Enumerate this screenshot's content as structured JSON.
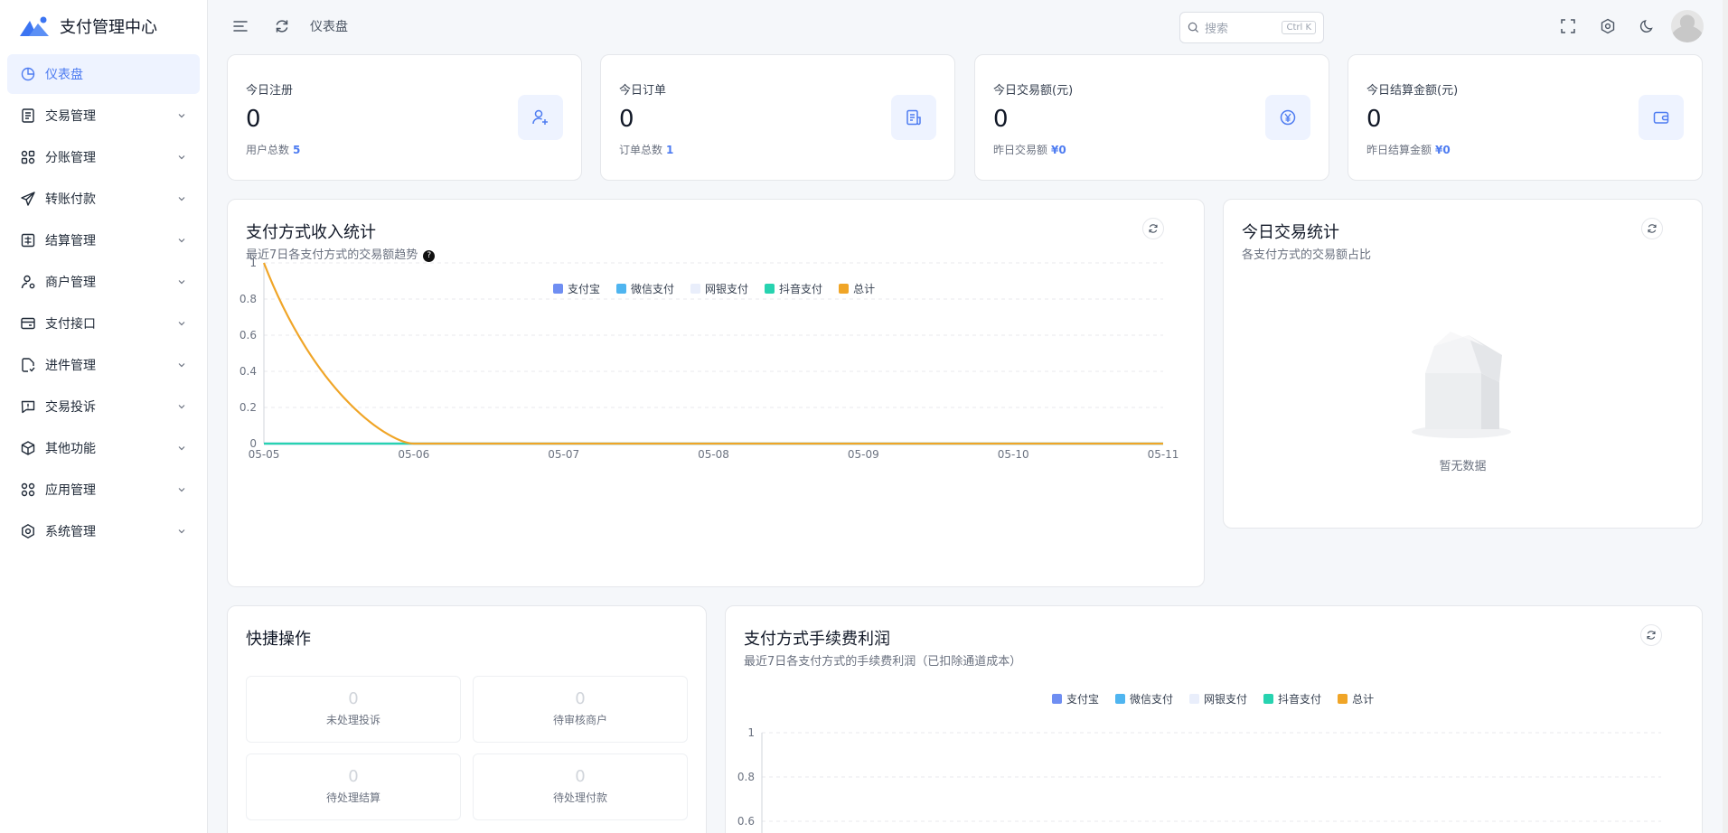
{
  "app": {
    "title": "支付管理中心"
  },
  "sidebar": {
    "items": [
      {
        "label": "仪表盘",
        "icon": "pie-chart-icon",
        "active": true
      },
      {
        "label": "交易管理",
        "icon": "document-icon"
      },
      {
        "label": "分账管理",
        "icon": "split-icon"
      },
      {
        "label": "转账付款",
        "icon": "send-icon"
      },
      {
        "label": "结算管理",
        "icon": "settlement-icon"
      },
      {
        "label": "商户管理",
        "icon": "user-settings-icon"
      },
      {
        "label": "支付接口",
        "icon": "card-icon"
      },
      {
        "label": "进件管理",
        "icon": "file-check-icon"
      },
      {
        "label": "交易投诉",
        "icon": "alert-message-icon"
      },
      {
        "label": "其他功能",
        "icon": "box-icon"
      },
      {
        "label": "应用管理",
        "icon": "apps-icon"
      },
      {
        "label": "系统管理",
        "icon": "settings-icon"
      }
    ]
  },
  "header": {
    "breadcrumb": "仪表盘",
    "search_placeholder": "搜索",
    "search_shortcut": "Ctrl K"
  },
  "stats": [
    {
      "label": "今日注册",
      "value": "0",
      "sub_label": "用户总数",
      "sub_value": "5",
      "icon": "user-plus-icon"
    },
    {
      "label": "今日订单",
      "value": "0",
      "sub_label": "订单总数",
      "sub_value": "1",
      "icon": "order-icon"
    },
    {
      "label": "今日交易额(元)",
      "value": "0",
      "sub_label": "昨日交易额",
      "sub_value": "¥0",
      "icon": "yen-icon"
    },
    {
      "label": "今日结算金额(元)",
      "value": "0",
      "sub_label": "昨日结算金额",
      "sub_value": "¥0",
      "icon": "wallet-icon"
    }
  ],
  "income_chart": {
    "title": "支付方式收入统计",
    "subtitle": "最近7日各支付方式的交易额趋势"
  },
  "today_chart": {
    "title": "今日交易统计",
    "subtitle": "各支付方式的交易额占比",
    "empty_text": "暂无数据"
  },
  "quick_actions": {
    "title": "快捷操作",
    "items": [
      {
        "value": "0",
        "label": "未处理投诉"
      },
      {
        "value": "0",
        "label": "待审核商户"
      },
      {
        "value": "0",
        "label": "待处理结算"
      },
      {
        "value": "0",
        "label": "待处理付款"
      }
    ]
  },
  "fee_chart": {
    "title": "支付方式手续费利润",
    "subtitle": "最近7日各支付方式的手续费利润（已扣除通道成本）"
  },
  "colors": {
    "accent": "#4e7cf1",
    "alipay": "#6f8ef2",
    "wechat": "#4fb5f0",
    "bank": "#e9eefb",
    "douyin": "#27d3b0",
    "total": "#f0a527"
  },
  "chart_data": [
    {
      "type": "line",
      "x": [
        "05-05",
        "05-06",
        "05-07",
        "05-08",
        "05-09",
        "05-10",
        "05-11"
      ],
      "ylim": [
        0,
        1
      ],
      "yticks": [
        "0",
        "0.2",
        "0.4",
        "0.6",
        "0.8",
        "1"
      ],
      "legend": "top-center",
      "grid": true,
      "series": [
        {
          "name": "支付宝",
          "values": [
            0,
            0,
            0,
            0,
            0,
            0,
            0
          ],
          "color": "#6f8ef2"
        },
        {
          "name": "微信支付",
          "values": [
            0,
            0,
            0,
            0,
            0,
            0,
            0
          ],
          "color": "#4fb5f0"
        },
        {
          "name": "网银支付",
          "values": [
            0,
            0,
            0,
            0,
            0,
            0,
            0
          ],
          "color": "#e9eefb"
        },
        {
          "name": "抖音支付",
          "values": [
            0,
            0,
            0,
            0,
            0,
            0,
            0
          ],
          "color": "#27d3b0"
        },
        {
          "name": "总计",
          "values": [
            1,
            0,
            0,
            0,
            0,
            0,
            0
          ],
          "color": "#f0a527"
        }
      ]
    },
    {
      "type": "line",
      "ylim": [
        0,
        1
      ],
      "yticks": [
        "0.6",
        "0.8",
        "1"
      ],
      "legend": "top-center",
      "grid": true,
      "series": [
        {
          "name": "支付宝",
          "color": "#6f8ef2"
        },
        {
          "name": "微信支付",
          "color": "#4fb5f0"
        },
        {
          "name": "网银支付",
          "color": "#e9eefb"
        },
        {
          "name": "抖音支付",
          "color": "#27d3b0"
        },
        {
          "name": "总计",
          "color": "#f0a527"
        }
      ]
    }
  ]
}
